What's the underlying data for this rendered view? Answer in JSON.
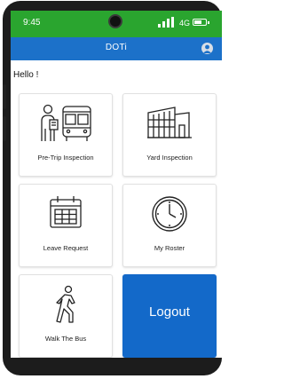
{
  "status_bar": {
    "time": "9:45",
    "network": "4G",
    "battery_level": 0.75
  },
  "app_bar": {
    "title": "DOTi"
  },
  "greeting": "Hello !",
  "tiles": [
    {
      "label": "Pre-Trip Inspection",
      "icon": "driver-bus-icon"
    },
    {
      "label": "Yard Inspection",
      "icon": "building-icon"
    },
    {
      "label": "Leave Request",
      "icon": "calendar-icon"
    },
    {
      "label": "My Roster",
      "icon": "clock-icon"
    },
    {
      "label": "Walk The Bus",
      "icon": "walking-person-icon"
    },
    {
      "label": "Logout",
      "icon": ""
    }
  ],
  "colors": {
    "status_bar": "#2aa52f",
    "app_bar": "#1c71c9",
    "logout_tile": "#1369c9"
  }
}
